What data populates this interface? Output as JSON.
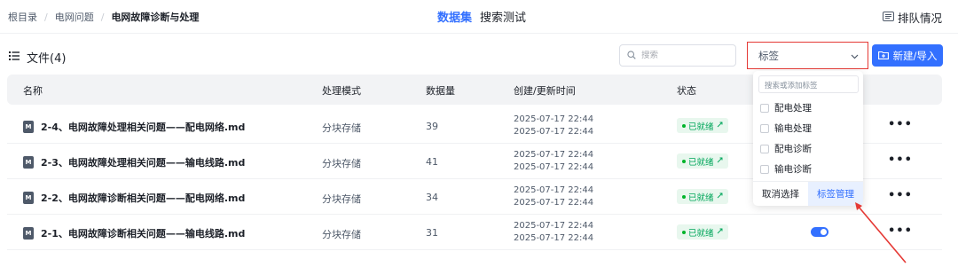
{
  "breadcrumb": {
    "root": "根目录",
    "level1": "电网问题",
    "current": "电网故障诊断与处理"
  },
  "tabs": {
    "dataset": "数据集",
    "search_test": "搜索测试"
  },
  "queue_label": "排队情况",
  "files_title": "文件(4)",
  "search": {
    "placeholder": "搜索"
  },
  "tag_select": {
    "placeholder": "标签"
  },
  "new_button": "新建/导入",
  "table": {
    "headers": {
      "name": "名称",
      "mode": "处理模式",
      "count": "数据量",
      "time": "创建/更新时间",
      "status": "状态"
    },
    "rows": [
      {
        "name": "2-4、电网故障处理相关问题——配电网络.md",
        "mode": "分块存储",
        "count": "39",
        "created": "2025-07-17 22:44",
        "updated": "2025-07-17 22:44",
        "status": "已就绪"
      },
      {
        "name": "2-3、电网故障处理相关问题——输电线路.md",
        "mode": "分块存储",
        "count": "41",
        "created": "2025-07-17 22:44",
        "updated": "2025-07-17 22:44",
        "status": "已就绪"
      },
      {
        "name": "2-2、电网故障诊断相关问题——配电网络.md",
        "mode": "分块存储",
        "count": "34",
        "created": "2025-07-17 22:44",
        "updated": "2025-07-17 22:44",
        "status": "已就绪"
      },
      {
        "name": "2-1、电网故障诊断相关问题——输电线路.md",
        "mode": "分块存储",
        "count": "31",
        "created": "2025-07-17 22:44",
        "updated": "2025-07-17 22:44",
        "status": "已就绪"
      }
    ],
    "more_label": "•••",
    "file_icon_letter": "M"
  },
  "tag_dropdown": {
    "search_placeholder": "搜索或添加标签",
    "options": [
      "配电处理",
      "输电处理",
      "配电诊断",
      "输电诊断"
    ],
    "cancel": "取消选择",
    "manage": "标签管理"
  },
  "colors": {
    "accent": "#3370ff",
    "ready": "#00a65a",
    "highlight": "#e53935"
  }
}
